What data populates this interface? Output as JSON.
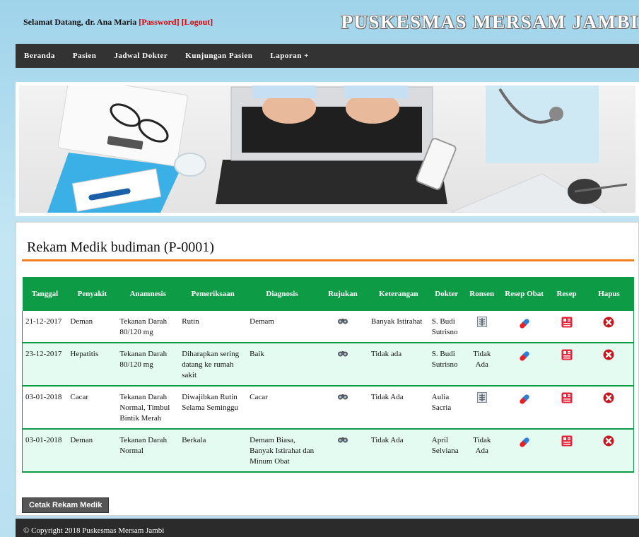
{
  "header": {
    "welcome_prefix": "Selamat Datang, dr. Ana Maria",
    "password_link": "[Password]",
    "logout_link": "[Logout]",
    "site_title": "PUSKESMAS MERSAM JAMBI"
  },
  "nav": {
    "items": [
      "Beranda",
      "Pasien",
      "Jadwal Dokter",
      "Kunjungan Pasien",
      "Laporan +"
    ]
  },
  "page": {
    "title": "Rekam Medik budiman (P-0001)"
  },
  "table": {
    "headers": [
      "Tanggal",
      "Penyakit",
      "Anamnesis",
      "Pemeriksaan",
      "Diagnosis",
      "Rujukan",
      "Keterangan",
      "Dokter",
      "Ronsen",
      "Resep Obat",
      "Resep",
      "Hapus"
    ],
    "rows": [
      {
        "tanggal": "21-12-2017",
        "penyakit": "Deman",
        "anamnesis": "Tekanan Darah 80/120 mg",
        "pemeriksaan": "Rutin",
        "diagnosis": "Demam",
        "keterangan": "Banyak Istirahat",
        "dokter": "S. Budi Sutrisno",
        "ronsen": "",
        "ronsen_icon": "xray-image-icon"
      },
      {
        "tanggal": "23-12-2017",
        "penyakit": "Hepatitis",
        "anamnesis": "Tekanan Darah 80/120 mg",
        "pemeriksaan": "Diharapkan sering datang ke rumah sakit",
        "diagnosis": "Baik",
        "keterangan": "Tidak ada",
        "dokter": "S. Budi Sutrisno",
        "ronsen": "Tidak Ada",
        "ronsen_icon": ""
      },
      {
        "tanggal": "03-01-2018",
        "penyakit": "Cacar",
        "anamnesis": "Tekanan Darah Normal, Timbul Bintik Merah",
        "pemeriksaan": "Diwajibkan Rutin Selama Seminggu",
        "diagnosis": "Cacar",
        "keterangan": "Tidak Ada",
        "dokter": "Aulia Sacria",
        "ronsen": "",
        "ronsen_icon": "xray-image-icon"
      },
      {
        "tanggal": "03-01-2018",
        "penyakit": "Deman",
        "anamnesis": "Tekanan Darah Normal",
        "pemeriksaan": "Berkala",
        "diagnosis": "Demam Biasa, Banyak Istirahat dan Minum Obat",
        "keterangan": "Tidak Ada",
        "dokter": "April Selviana",
        "ronsen": "Tidak Ada",
        "ronsen_icon": ""
      }
    ]
  },
  "actions": {
    "print_button": "Cetak Rekam Medik"
  },
  "footer": {
    "copyright": "© Copyright 2018 Puskesmas Mersam Jambi"
  },
  "colors": {
    "table_header": "#0e9b46",
    "row_alt": "#e4fbf2",
    "accent_rule": "#f47d1f",
    "nav_bg": "#333333",
    "link_red": "#e30000"
  },
  "icons": {
    "rujukan": "binoculars-icon",
    "resep_obat": "pill-capsule-icon",
    "resep": "prescription-icon",
    "hapus": "delete-x-icon"
  }
}
